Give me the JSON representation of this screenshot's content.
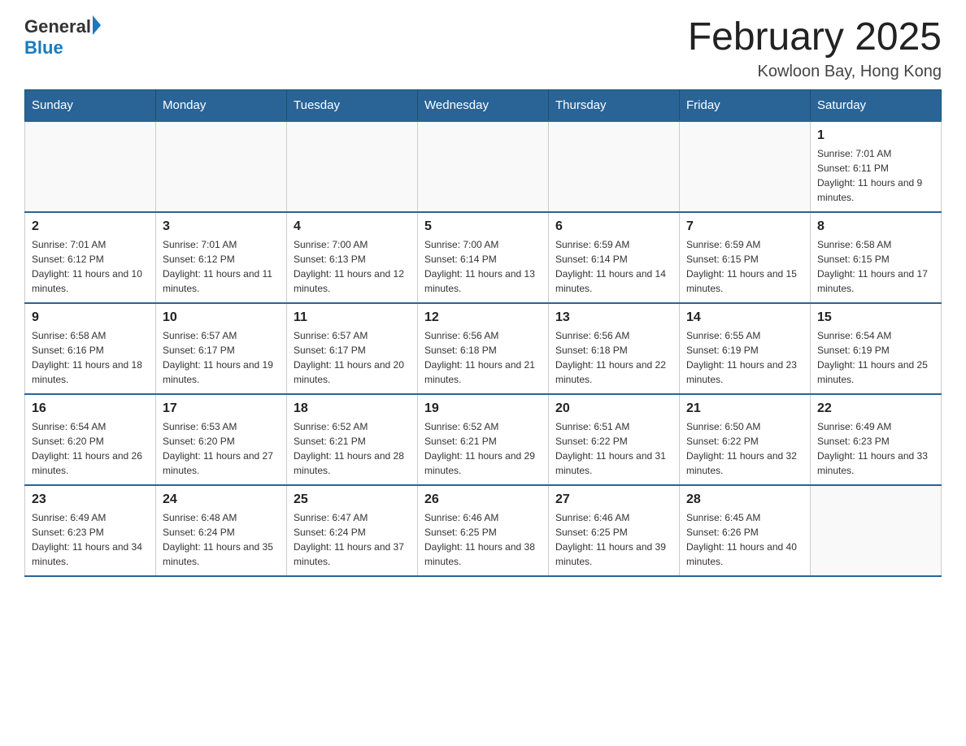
{
  "header": {
    "logo_general": "General",
    "logo_blue": "Blue",
    "month_title": "February 2025",
    "location": "Kowloon Bay, Hong Kong"
  },
  "days_of_week": [
    "Sunday",
    "Monday",
    "Tuesday",
    "Wednesday",
    "Thursday",
    "Friday",
    "Saturday"
  ],
  "weeks": [
    [
      {
        "day": "",
        "info": ""
      },
      {
        "day": "",
        "info": ""
      },
      {
        "day": "",
        "info": ""
      },
      {
        "day": "",
        "info": ""
      },
      {
        "day": "",
        "info": ""
      },
      {
        "day": "",
        "info": ""
      },
      {
        "day": "1",
        "info": "Sunrise: 7:01 AM\nSunset: 6:11 PM\nDaylight: 11 hours and 9 minutes."
      }
    ],
    [
      {
        "day": "2",
        "info": "Sunrise: 7:01 AM\nSunset: 6:12 PM\nDaylight: 11 hours and 10 minutes."
      },
      {
        "day": "3",
        "info": "Sunrise: 7:01 AM\nSunset: 6:12 PM\nDaylight: 11 hours and 11 minutes."
      },
      {
        "day": "4",
        "info": "Sunrise: 7:00 AM\nSunset: 6:13 PM\nDaylight: 11 hours and 12 minutes."
      },
      {
        "day": "5",
        "info": "Sunrise: 7:00 AM\nSunset: 6:14 PM\nDaylight: 11 hours and 13 minutes."
      },
      {
        "day": "6",
        "info": "Sunrise: 6:59 AM\nSunset: 6:14 PM\nDaylight: 11 hours and 14 minutes."
      },
      {
        "day": "7",
        "info": "Sunrise: 6:59 AM\nSunset: 6:15 PM\nDaylight: 11 hours and 15 minutes."
      },
      {
        "day": "8",
        "info": "Sunrise: 6:58 AM\nSunset: 6:15 PM\nDaylight: 11 hours and 17 minutes."
      }
    ],
    [
      {
        "day": "9",
        "info": "Sunrise: 6:58 AM\nSunset: 6:16 PM\nDaylight: 11 hours and 18 minutes."
      },
      {
        "day": "10",
        "info": "Sunrise: 6:57 AM\nSunset: 6:17 PM\nDaylight: 11 hours and 19 minutes."
      },
      {
        "day": "11",
        "info": "Sunrise: 6:57 AM\nSunset: 6:17 PM\nDaylight: 11 hours and 20 minutes."
      },
      {
        "day": "12",
        "info": "Sunrise: 6:56 AM\nSunset: 6:18 PM\nDaylight: 11 hours and 21 minutes."
      },
      {
        "day": "13",
        "info": "Sunrise: 6:56 AM\nSunset: 6:18 PM\nDaylight: 11 hours and 22 minutes."
      },
      {
        "day": "14",
        "info": "Sunrise: 6:55 AM\nSunset: 6:19 PM\nDaylight: 11 hours and 23 minutes."
      },
      {
        "day": "15",
        "info": "Sunrise: 6:54 AM\nSunset: 6:19 PM\nDaylight: 11 hours and 25 minutes."
      }
    ],
    [
      {
        "day": "16",
        "info": "Sunrise: 6:54 AM\nSunset: 6:20 PM\nDaylight: 11 hours and 26 minutes."
      },
      {
        "day": "17",
        "info": "Sunrise: 6:53 AM\nSunset: 6:20 PM\nDaylight: 11 hours and 27 minutes."
      },
      {
        "day": "18",
        "info": "Sunrise: 6:52 AM\nSunset: 6:21 PM\nDaylight: 11 hours and 28 minutes."
      },
      {
        "day": "19",
        "info": "Sunrise: 6:52 AM\nSunset: 6:21 PM\nDaylight: 11 hours and 29 minutes."
      },
      {
        "day": "20",
        "info": "Sunrise: 6:51 AM\nSunset: 6:22 PM\nDaylight: 11 hours and 31 minutes."
      },
      {
        "day": "21",
        "info": "Sunrise: 6:50 AM\nSunset: 6:22 PM\nDaylight: 11 hours and 32 minutes."
      },
      {
        "day": "22",
        "info": "Sunrise: 6:49 AM\nSunset: 6:23 PM\nDaylight: 11 hours and 33 minutes."
      }
    ],
    [
      {
        "day": "23",
        "info": "Sunrise: 6:49 AM\nSunset: 6:23 PM\nDaylight: 11 hours and 34 minutes."
      },
      {
        "day": "24",
        "info": "Sunrise: 6:48 AM\nSunset: 6:24 PM\nDaylight: 11 hours and 35 minutes."
      },
      {
        "day": "25",
        "info": "Sunrise: 6:47 AM\nSunset: 6:24 PM\nDaylight: 11 hours and 37 minutes."
      },
      {
        "day": "26",
        "info": "Sunrise: 6:46 AM\nSunset: 6:25 PM\nDaylight: 11 hours and 38 minutes."
      },
      {
        "day": "27",
        "info": "Sunrise: 6:46 AM\nSunset: 6:25 PM\nDaylight: 11 hours and 39 minutes."
      },
      {
        "day": "28",
        "info": "Sunrise: 6:45 AM\nSunset: 6:26 PM\nDaylight: 11 hours and 40 minutes."
      },
      {
        "day": "",
        "info": ""
      }
    ]
  ]
}
